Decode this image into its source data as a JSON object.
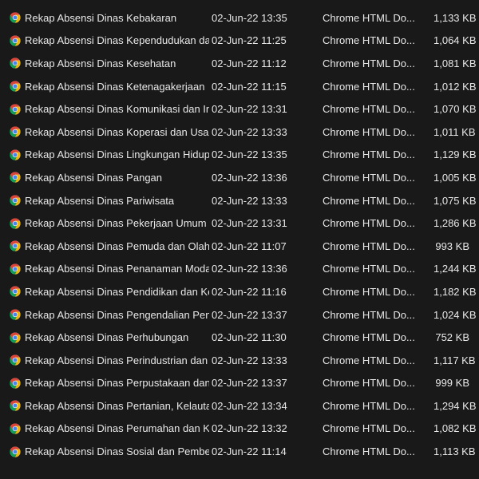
{
  "files": [
    {
      "name": "Rekap Absensi Dinas Kebakaran",
      "date": "02-Jun-22 13:35",
      "type": "Chrome HTML Do...",
      "size": "1,133 KB",
      "icon": "chrome-icon"
    },
    {
      "name": "Rekap Absensi Dinas Kependudukan dan ...",
      "date": "02-Jun-22 11:25",
      "type": "Chrome HTML Do...",
      "size": "1,064 KB",
      "icon": "chrome-icon"
    },
    {
      "name": "Rekap Absensi Dinas Kesehatan",
      "date": "02-Jun-22 11:12",
      "type": "Chrome HTML Do...",
      "size": "1,081 KB",
      "icon": "chrome-icon"
    },
    {
      "name": "Rekap Absensi Dinas Ketenagakerjaan",
      "date": "02-Jun-22 11:15",
      "type": "Chrome HTML Do...",
      "size": "1,012 KB",
      "icon": "chrome-icon"
    },
    {
      "name": "Rekap Absensi Dinas Komunikasi dan Inf...",
      "date": "02-Jun-22 13:31",
      "type": "Chrome HTML Do...",
      "size": "1,070 KB",
      "icon": "chrome-icon"
    },
    {
      "name": "Rekap Absensi Dinas Koperasi dan Usaha ...",
      "date": "02-Jun-22 13:33",
      "type": "Chrome HTML Do...",
      "size": "1,011 KB",
      "icon": "chrome-icon"
    },
    {
      "name": "Rekap Absensi Dinas Lingkungan Hidup",
      "date": "02-Jun-22 13:35",
      "type": "Chrome HTML Do...",
      "size": "1,129 KB",
      "icon": "chrome-icon"
    },
    {
      "name": "Rekap Absensi Dinas Pangan",
      "date": "02-Jun-22 13:36",
      "type": "Chrome HTML Do...",
      "size": "1,005 KB",
      "icon": "chrome-icon"
    },
    {
      "name": "Rekap Absensi Dinas Pariwisata",
      "date": "02-Jun-22 13:33",
      "type": "Chrome HTML Do...",
      "size": "1,075 KB",
      "icon": "chrome-icon"
    },
    {
      "name": "Rekap Absensi Dinas Pekerjaan Umum d...",
      "date": "02-Jun-22 13:31",
      "type": "Chrome HTML Do...",
      "size": "1,286 KB",
      "icon": "chrome-icon"
    },
    {
      "name": "Rekap Absensi Dinas Pemuda dan Olahra...",
      "date": "02-Jun-22 11:07",
      "type": "Chrome HTML Do...",
      "size": "993 KB",
      "icon": "chrome-icon"
    },
    {
      "name": "Rekap Absensi Dinas Penanaman Modal ...",
      "date": "02-Jun-22 13:36",
      "type": "Chrome HTML Do...",
      "size": "1,244 KB",
      "icon": "chrome-icon"
    },
    {
      "name": "Rekap Absensi Dinas Pendidikan dan Keb...",
      "date": "02-Jun-22 11:16",
      "type": "Chrome HTML Do...",
      "size": "1,182 KB",
      "icon": "chrome-icon"
    },
    {
      "name": "Rekap Absensi Dinas Pengendalian Pend...",
      "date": "02-Jun-22 13:37",
      "type": "Chrome HTML Do...",
      "size": "1,024 KB",
      "icon": "chrome-icon"
    },
    {
      "name": "Rekap Absensi Dinas Perhubungan",
      "date": "02-Jun-22 11:30",
      "type": "Chrome HTML Do...",
      "size": "752 KB",
      "icon": "chrome-icon"
    },
    {
      "name": "Rekap Absensi Dinas Perindustrian dan P...",
      "date": "02-Jun-22 13:33",
      "type": "Chrome HTML Do...",
      "size": "1,117 KB",
      "icon": "chrome-icon"
    },
    {
      "name": "Rekap Absensi Dinas Perpustakaan dan K...",
      "date": "02-Jun-22 13:37",
      "type": "Chrome HTML Do...",
      "size": "999 KB",
      "icon": "chrome-icon"
    },
    {
      "name": "Rekap Absensi Dinas Pertanian, Kelautan ...",
      "date": "02-Jun-22 13:34",
      "type": "Chrome HTML Do...",
      "size": "1,294 KB",
      "icon": "chrome-icon"
    },
    {
      "name": "Rekap Absensi Dinas Perumahan dan Ka...",
      "date": "02-Jun-22 13:32",
      "type": "Chrome HTML Do...",
      "size": "1,082 KB",
      "icon": "chrome-icon"
    },
    {
      "name": "Rekap Absensi Dinas Sosial dan Pemberd...",
      "date": "02-Jun-22 11:14",
      "type": "Chrome HTML Do...",
      "size": "1,113 KB",
      "icon": "chrome-icon"
    }
  ],
  "colors": {
    "background": "#191919",
    "text": "#e8e8e8",
    "chrome_red": "#db4437",
    "chrome_yellow": "#f4b400",
    "chrome_green": "#0f9d58",
    "chrome_blue": "#4285f4"
  }
}
